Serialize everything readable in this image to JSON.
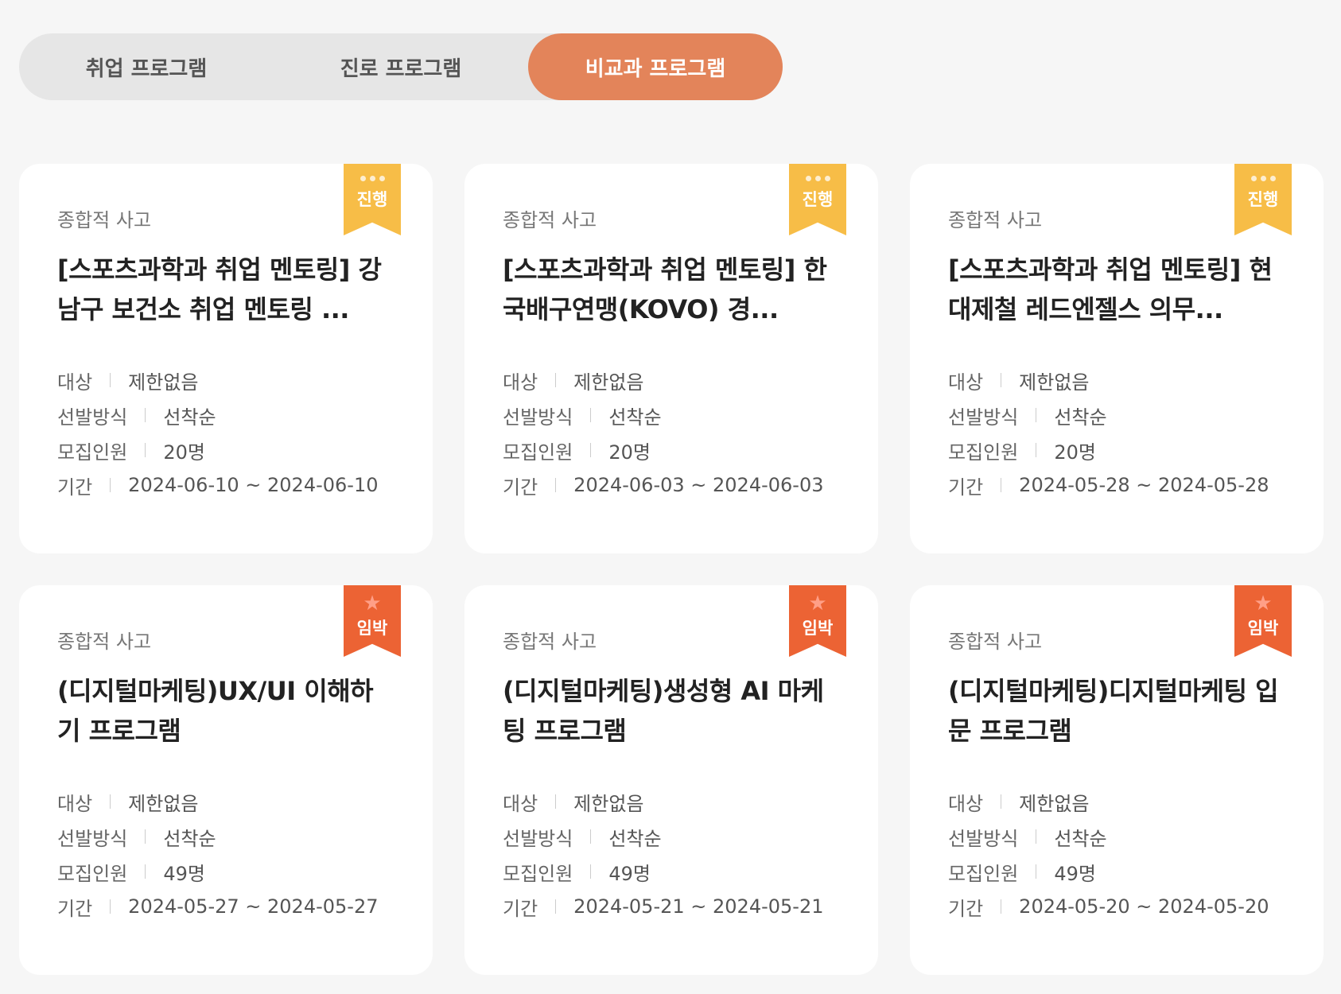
{
  "tabs": [
    {
      "label": "취업 프로그램",
      "active": false
    },
    {
      "label": "진로 프로그램",
      "active": false
    },
    {
      "label": "비교과 프로그램",
      "active": true
    }
  ],
  "info_labels": {
    "target": "대상",
    "method": "선발방식",
    "capacity": "모집인원",
    "period": "기간"
  },
  "colors": {
    "accent": "#e3845a",
    "badge_progress": "#f7bd47",
    "badge_urgent": "#ec6334"
  },
  "cards": [
    {
      "badge": "진행",
      "badge_type": "progress",
      "badge_icon": "dots-icon",
      "category": "종합적 사고",
      "title": "[스포츠과학과 취업 멘토링] 강남구 보건소 취업 멘토링 ...",
      "target": "제한없음",
      "method": "선착순",
      "capacity": "20명",
      "period": "2024-06-10 ~ 2024-06-10"
    },
    {
      "badge": "진행",
      "badge_type": "progress",
      "badge_icon": "dots-icon",
      "category": "종합적 사고",
      "title": "[스포츠과학과 취업 멘토링] 한국배구연맹(KOVO) 경...",
      "target": "제한없음",
      "method": "선착순",
      "capacity": "20명",
      "period": "2024-06-03 ~ 2024-06-03"
    },
    {
      "badge": "진행",
      "badge_type": "progress",
      "badge_icon": "dots-icon",
      "category": "종합적 사고",
      "title": "[스포츠과학과 취업 멘토링] 현대제철 레드엔젤스 의무...",
      "target": "제한없음",
      "method": "선착순",
      "capacity": "20명",
      "period": "2024-05-28 ~ 2024-05-28"
    },
    {
      "badge": "임박",
      "badge_type": "urgent",
      "badge_icon": "star-icon",
      "category": "종합적 사고",
      "title": "(디지털마케팅)UX/UI 이해하기 프로그램",
      "target": "제한없음",
      "method": "선착순",
      "capacity": "49명",
      "period": "2024-05-27 ~ 2024-05-27"
    },
    {
      "badge": "임박",
      "badge_type": "urgent",
      "badge_icon": "star-icon",
      "category": "종합적 사고",
      "title": "(디지털마케팅)생성형 AI 마케팅 프로그램",
      "target": "제한없음",
      "method": "선착순",
      "capacity": "49명",
      "period": "2024-05-21 ~ 2024-05-21"
    },
    {
      "badge": "임박",
      "badge_type": "urgent",
      "badge_icon": "star-icon",
      "category": "종합적 사고",
      "title": "(디지털마케팅)디지털마케팅 입문 프로그램",
      "target": "제한없음",
      "method": "선착순",
      "capacity": "49명",
      "period": "2024-05-20 ~ 2024-05-20"
    }
  ]
}
